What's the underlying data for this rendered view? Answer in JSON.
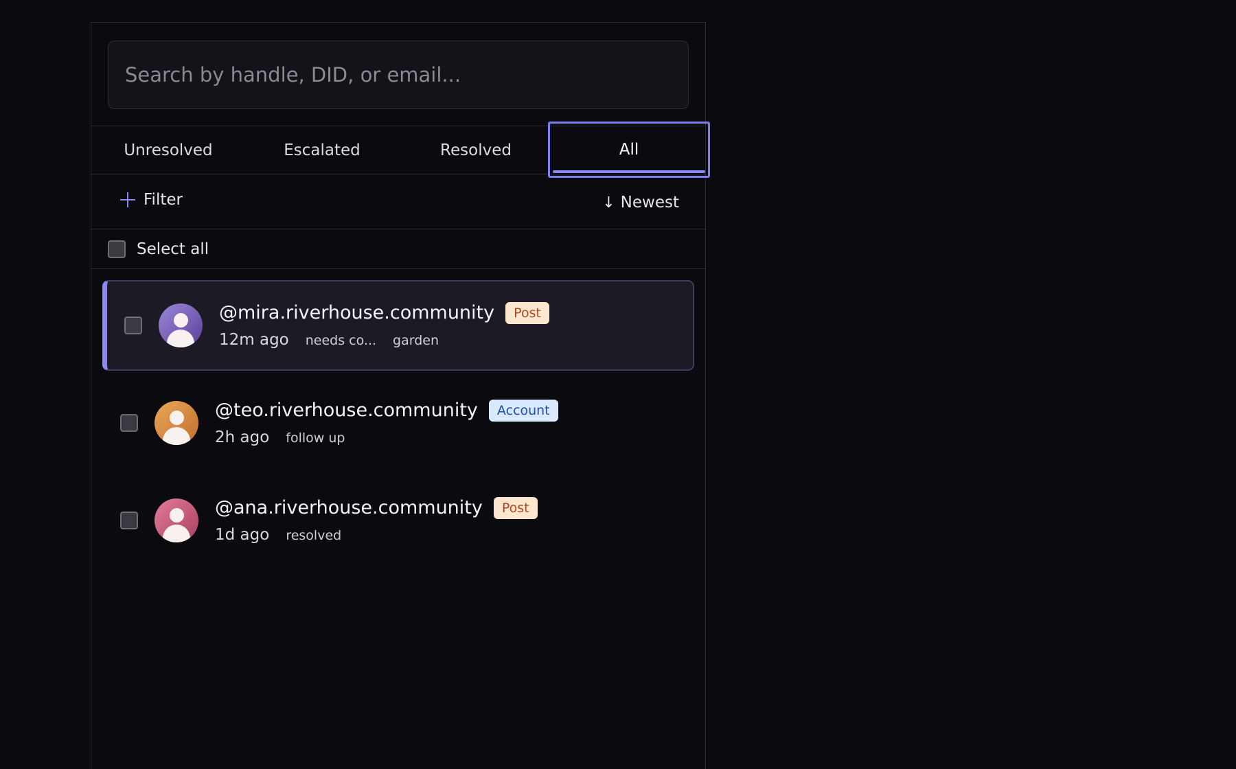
{
  "search": {
    "placeholder": "Search by handle, DID, or email..."
  },
  "tabs": [
    {
      "label": "Unresolved"
    },
    {
      "label": "Escalated"
    },
    {
      "label": "Resolved"
    },
    {
      "label": "All",
      "active": true
    }
  ],
  "toolbar": {
    "filter_label": "Filter",
    "filter_icon": "plus-icon",
    "sort_label": "Newest",
    "sort_icon": "arrow-down-icon"
  },
  "select_all_label": "Select all",
  "reports": [
    {
      "handle": "@mira.riverhouse.community",
      "type": "Post",
      "time": "12m ago",
      "tags": [
        "needs co...",
        "garden"
      ],
      "selected": true,
      "avatar_color": "#7a62b8"
    },
    {
      "handle": "@teo.riverhouse.community",
      "type": "Account",
      "time": "2h ago",
      "tags": [
        "follow up"
      ],
      "selected": false,
      "avatar_color": "#d88a40"
    },
    {
      "handle": "@ana.riverhouse.community",
      "type": "Post",
      "time": "1d ago",
      "tags": [
        "resolved"
      ],
      "selected": false,
      "avatar_color": "#c45a7b"
    }
  ],
  "colors": {
    "accent": "#8a88f5",
    "background": "#0a0a0f",
    "badge_post_bg": "#fde8cf",
    "badge_post_text": "#b0461f",
    "badge_account_bg": "#dbe9ff",
    "badge_account_text": "#1d4fb0"
  }
}
